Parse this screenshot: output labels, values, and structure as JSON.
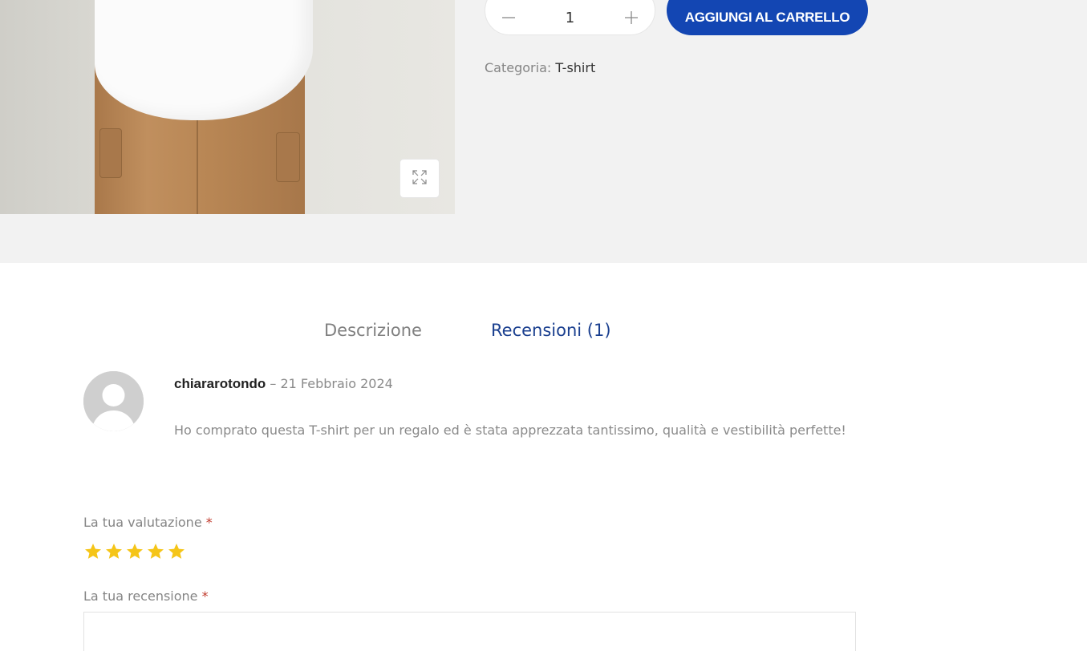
{
  "product": {
    "image_alt": "",
    "quantity_value": "1",
    "add_to_cart_label": "AGGIUNGI AL CARRELLO",
    "category_label": "Categoria:",
    "category_value": "T-shirt"
  },
  "tabs": [
    {
      "label": "Descrizione",
      "active": false
    },
    {
      "label": "Recensioni (1)",
      "active": true
    }
  ],
  "review": {
    "author": "chiararotondo",
    "separator": " – ",
    "date": "21 Febbraio 2024",
    "text": "Ho comprato questa T-shirt per un regalo ed è stata apprezzata tantissimo, qualità e vestibilità perfette!"
  },
  "form": {
    "rating_label": "La tua valutazione",
    "review_label": "La tua recensione",
    "required_mark": "*",
    "stars_count": 5
  },
  "colors": {
    "accent": "#1346b3",
    "tab_active": "#1a3f8f",
    "star": "#f5c518",
    "required": "#c0392b",
    "band": "#f2f2f2"
  },
  "icons": [
    "expand-icon",
    "minus-icon",
    "plus-icon",
    "avatar-placeholder-icon",
    "star-icon"
  ]
}
